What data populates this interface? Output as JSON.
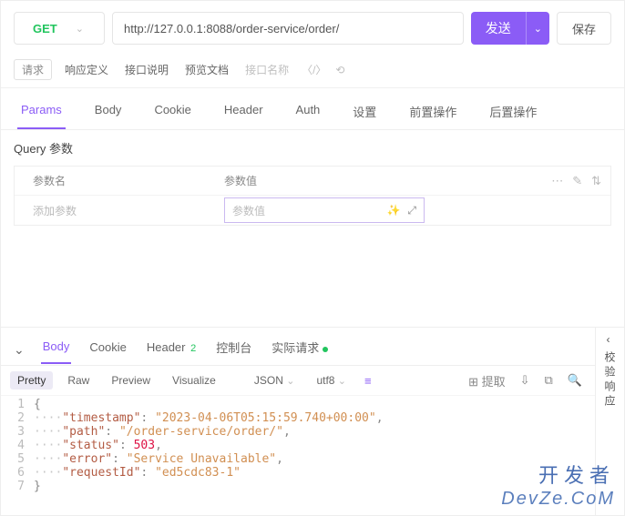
{
  "request": {
    "method": "GET",
    "url": "http://127.0.0.1:8088/order-service/order/",
    "send_label": "发送",
    "save_label": "保存"
  },
  "top_tabs": {
    "t1": "请求",
    "t2": "响应定义",
    "t3": "接口说明",
    "t4": "预览文档",
    "placeholder": "接口名称"
  },
  "subtabs": {
    "params": "Params",
    "body": "Body",
    "cookie": "Cookie",
    "header": "Header",
    "auth": "Auth",
    "settings": "设置",
    "pre": "前置操作",
    "post": "后置操作"
  },
  "query": {
    "title": "Query 参数",
    "col_name": "参数名",
    "col_value": "参数值",
    "add_param": "添加参数",
    "value_placeholder": "参数值"
  },
  "response": {
    "tabs": {
      "body": "Body",
      "cookie": "Cookie",
      "header": "Header",
      "header_count": "2",
      "console": "控制台",
      "actual": "实际请求"
    },
    "views": {
      "pretty": "Pretty",
      "raw": "Raw",
      "preview": "Preview",
      "visualize": "Visualize",
      "format": "JSON",
      "encoding": "utf8"
    },
    "extract_label": "提取",
    "side_label": "校验响应",
    "body_json": {
      "timestamp": "2023-04-06T05:15:59.740+00:00",
      "path": "/order-service/order/",
      "status": 503,
      "error": "Service Unavailable",
      "requestId": "ed5cdc83-1"
    }
  },
  "watermark": {
    "line1": "开发者",
    "line2": "DevZe.CoM"
  }
}
